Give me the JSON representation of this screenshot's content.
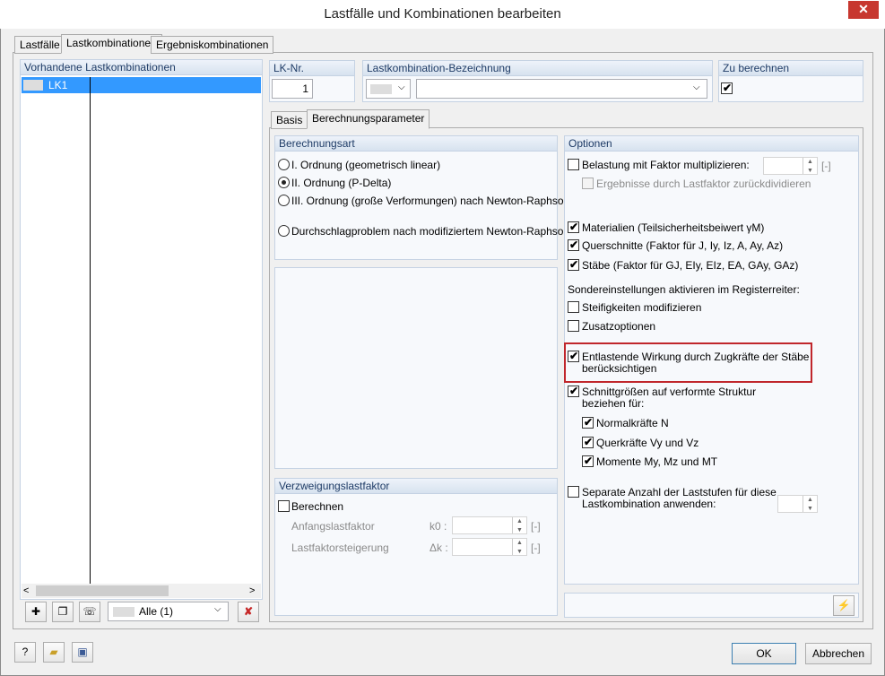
{
  "window": {
    "title": "Lastfälle und Kombinationen bearbeiten",
    "close_glyph": "✕"
  },
  "tabs": [
    "Lastfälle",
    "Lastkombinationen",
    "Ergebniskombinationen"
  ],
  "left_panel": {
    "header": "Vorhandene Lastkombinationen",
    "items": [
      {
        "label": "LK1",
        "selected": true
      }
    ],
    "filter_value": "Alle (1)",
    "scroll_left": "<",
    "scroll_right": ">"
  },
  "fields": {
    "lk_nr_label": "LK-Nr.",
    "lk_nr_value": "1",
    "bezeichnung_label": "Lastkombination-Bezeichnung",
    "bezeichnung_value": "",
    "zu_berechnen_label": "Zu berechnen",
    "zu_berechnen_checked": true
  },
  "subtabs": [
    "Basis",
    "Berechnungsparameter"
  ],
  "berechnungsart": {
    "header": "Berechnungsart",
    "options": [
      {
        "label": "I. Ordnung (geometrisch linear)",
        "selected": false
      },
      {
        "label": "II. Ordnung (P-Delta)",
        "selected": true
      },
      {
        "label": "III. Ordnung (große Verformungen) nach Newton-Raphson",
        "selected": false
      },
      {
        "label": "Durchschlagproblem nach modifiziertem Newton-Raphson",
        "selected": false
      }
    ]
  },
  "verzweigung": {
    "header": "Verzweigungslastfaktor",
    "berechnen_label": "Berechnen",
    "anfangs_label": "Anfangslastfaktor",
    "anfangs_symbol": "k0 :",
    "steigerung_label": "Lastfaktorsteigerung",
    "steigerung_symbol": "Δk :",
    "unit": "[-]"
  },
  "optionen": {
    "header": "Optionen",
    "belastung_label": "Belastung mit Faktor multiplizieren:",
    "belastung_unit": "[-]",
    "ergebnisse_label": "Ergebnisse durch Lastfaktor zurückdividieren",
    "materialien_label": "Materialien (Teilsicherheitsbeiwert γM)",
    "querschnitte_label": "Querschnitte (Faktor für J, Iy, Iz, A, Ay, Az)",
    "staebe_label": "Stäbe (Faktor für GJ, EIy, EIz, EA, GAy, GAz)",
    "sonder_label": "Sondereinstellungen aktivieren im Registerreiter:",
    "steifigkeiten_label": "Steifigkeiten modifizieren",
    "zusatz_label": "Zusatzoptionen",
    "entlastend_line1": "Entlastende Wirkung durch Zugkräfte der Stäbe",
    "entlastend_line2": "berücksichtigen",
    "schnitt_line1": "Schnittgrößen auf verformte Struktur",
    "schnitt_line2": "beziehen für:",
    "normal_label": "Normalkräfte N",
    "quer_label": "Querkräfte Vy und Vz",
    "momente_label": "Momente My, Mz und MT",
    "separate_line1": "Separate Anzahl der Laststufen für diese",
    "separate_line2": "Lastkombination anwenden:"
  },
  "buttons": {
    "ok": "OK",
    "cancel": "Abbrechen"
  },
  "checkmark": "✔"
}
